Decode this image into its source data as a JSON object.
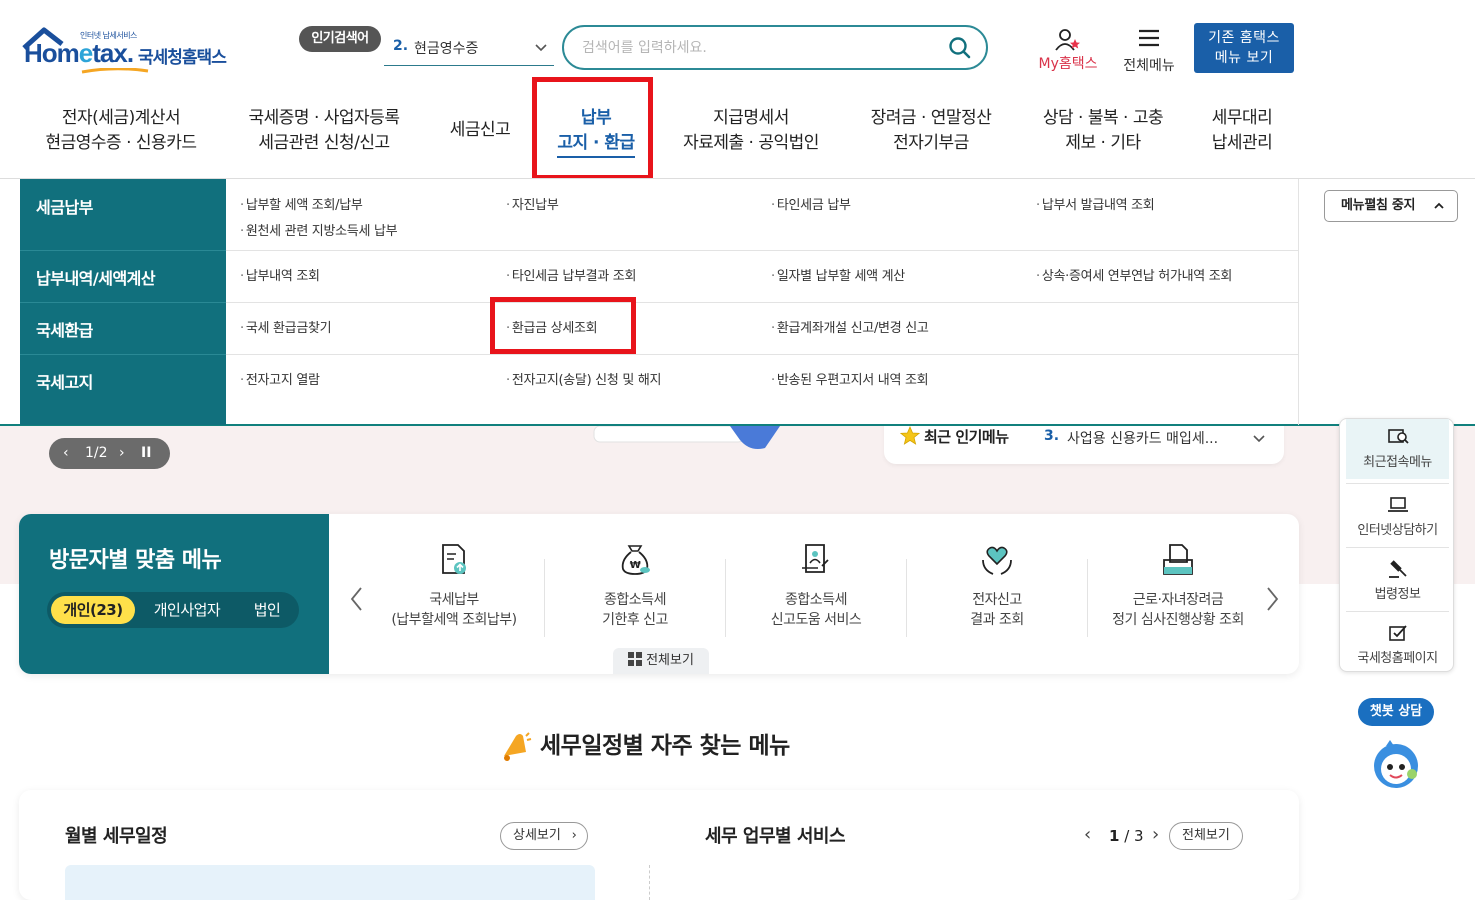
{
  "header": {
    "logo_small": "인터넷 납세서비스",
    "logo_word": "Hometax.",
    "logo_kr": "국세청홈택스",
    "popular_badge": "인기검색어",
    "popular_rank": "2.",
    "popular_term": "현금영수증",
    "search_placeholder": "검색어를 입력하세요.",
    "my_hometax": "My홈택스",
    "all_menu": "전체메뉴",
    "old_menu_line1": "기존 홈택스",
    "old_menu_line2": "메뉴 보기"
  },
  "gnb": [
    {
      "line1": "전자(세금)계산서",
      "line2": "현금영수증 · 신용카드"
    },
    {
      "line1": "국세증명 · 사업자등록",
      "line2": "세금관련 신청/신고"
    },
    {
      "line1": "세금신고",
      "line2": ""
    },
    {
      "line1": "납부",
      "line2": "고지 · 환급"
    },
    {
      "line1": "지급명세서",
      "line2": "자료제출 · 공익법인"
    },
    {
      "line1": "장려금 · 연말정산",
      "line2": "전자기부금"
    },
    {
      "line1": "상담 · 불복 · 고충",
      "line2": "제보 · 기타"
    },
    {
      "line1": "세무대리",
      "line2": "납세관리"
    }
  ],
  "dropdown": {
    "categories": [
      "세금납부",
      "납부내역/세액계산",
      "국세환급",
      "국세고지"
    ],
    "rows": [
      [
        "납부할 세액 조회/납부",
        "자진납부",
        "타인세금 납부",
        "납부서 발급내역 조회",
        "원천세 관련 지방소득세 납부"
      ],
      [
        "납부내역 조회",
        "타인세금 납부결과 조회",
        "일자별 납부할 세액 계산",
        "상속·증여세 연부연납 허가내역 조회"
      ],
      [
        "국세 환급금찾기",
        "환급금 상세조회",
        "환급계좌개설 신고/변경 신고"
      ],
      [
        "전자고지 열람",
        "전자고지(송달) 신청 및 해지",
        "반송된 우편고지서 내역 조회"
      ]
    ],
    "stop_button": "메뉴펼침 중지"
  },
  "hero": {
    "pager": "1/2",
    "recent_title": "최근 인기메뉴",
    "recent_rank": "3.",
    "recent_item": "사업용 신용카드 매입세..."
  },
  "sidebar": [
    "최근접속메뉴",
    "인터넷상담하기",
    "법령정보",
    "국세청홈페이지"
  ],
  "chatbot": "챗봇 상담",
  "visitor": {
    "title": "방문자별 맞춤 메뉴",
    "tabs": [
      "개인(23)",
      "개인사업자",
      "법인"
    ],
    "items": [
      {
        "line1": "국세납부",
        "line2": "(납부할세액 조회납부)"
      },
      {
        "line1": "종합소득세",
        "line2": "기한후 신고"
      },
      {
        "line1": "종합소득세",
        "line2": "신고도움 서비스"
      },
      {
        "line1": "전자신고",
        "line2": "결과 조회"
      },
      {
        "line1": "근로·자녀장려금",
        "line2": "정기 심사진행상황 조회"
      }
    ],
    "all_view": "전체보기"
  },
  "schedule_title": "세무일정별 자주 찾는 메뉴",
  "monthly": {
    "title": "월별 세무일정",
    "detail": "상세보기"
  },
  "services": {
    "title": "세무 업무별 서비스",
    "page_current": "1",
    "page_total": "3",
    "all_view": "전체보기"
  },
  "colors": {
    "teal": "#11707d",
    "blue": "#1a5fa8",
    "red": "#e8141b",
    "yellow": "#ffe04a"
  }
}
